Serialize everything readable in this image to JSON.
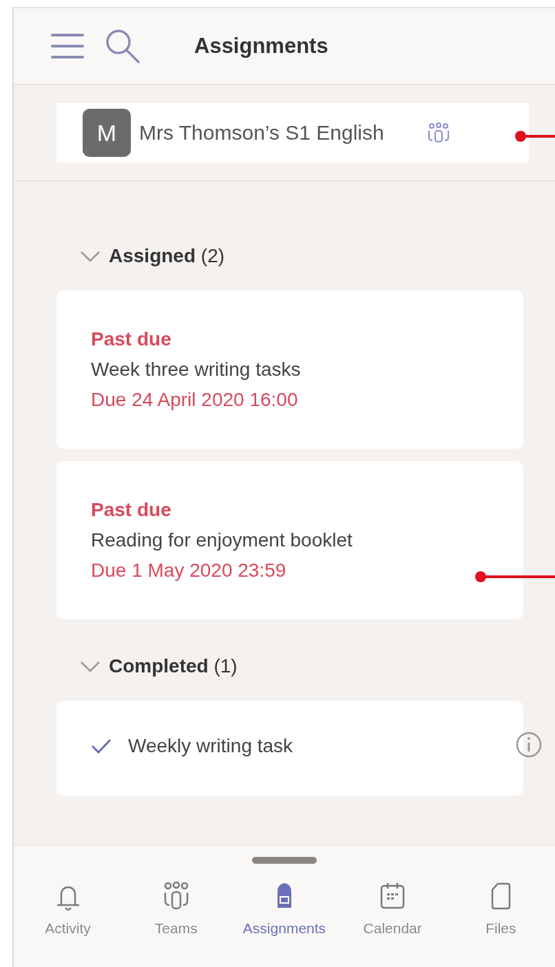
{
  "header": {
    "title": "Assignments"
  },
  "class": {
    "initial": "M",
    "name": "Mrs Thomson’s S1 English"
  },
  "sections": [
    {
      "title": "Assigned",
      "count": "(2)",
      "expanded": true,
      "items": [
        {
          "kind": "due",
          "status": "Past due",
          "title": "Week three writing tasks",
          "due": "Due 24 April 2020 16:00"
        },
        {
          "kind": "due",
          "status": "Past due",
          "title": "Reading for enjoyment booklet",
          "due": "Due 1 May 2020 23:59"
        }
      ]
    },
    {
      "title": "Completed",
      "count": "(1)",
      "expanded": true,
      "items": [
        {
          "kind": "done",
          "title": "Weekly writing task"
        }
      ]
    }
  ],
  "nav": [
    {
      "label": "Activity",
      "kind": "bell",
      "selected": false
    },
    {
      "label": "Teams",
      "kind": "teams",
      "selected": false
    },
    {
      "label": "Assignments",
      "kind": "bag",
      "selected": true
    },
    {
      "label": "Calendar",
      "kind": "calendar",
      "selected": false
    },
    {
      "label": "Files",
      "kind": "file",
      "selected": false
    }
  ]
}
